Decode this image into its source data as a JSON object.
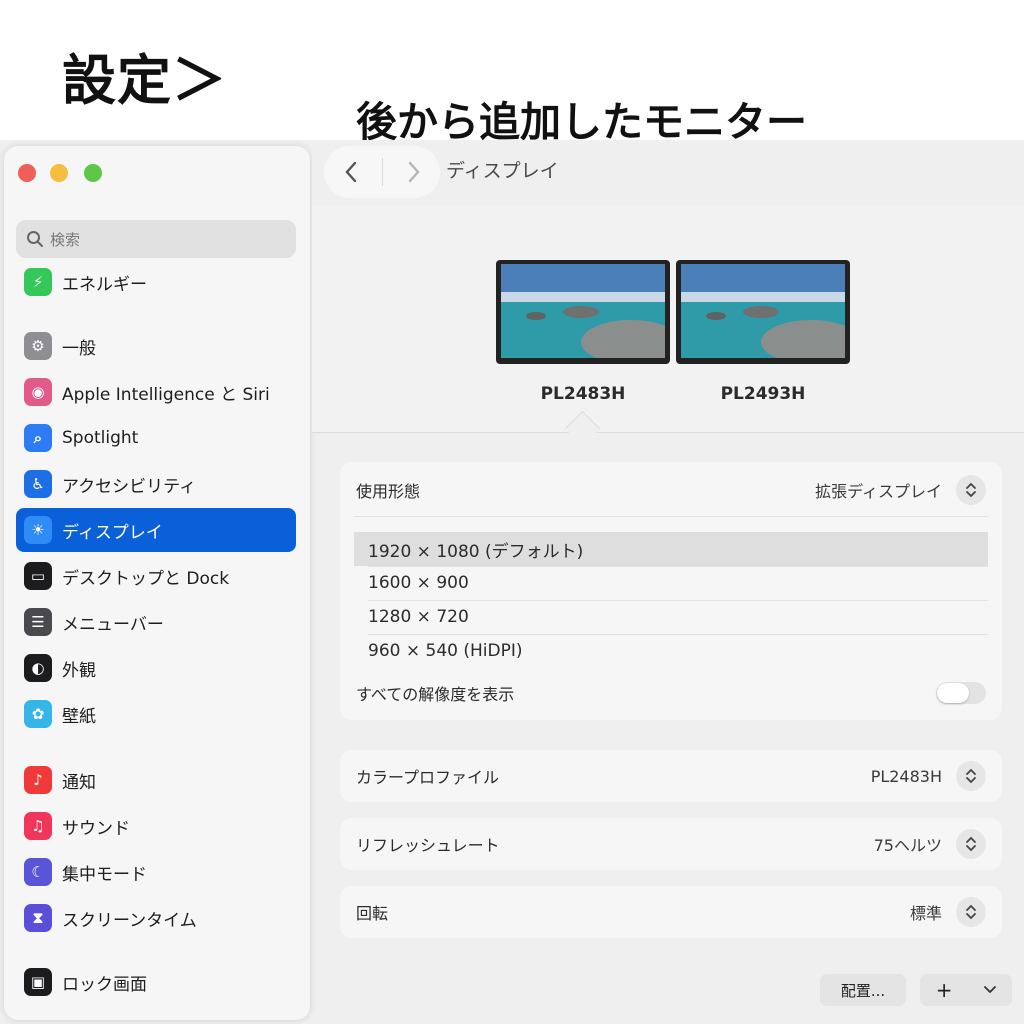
{
  "annotation": {
    "heading": "設定＞",
    "subheading": "後から追加したモニター"
  },
  "window": {
    "title": "ディスプレイ"
  },
  "sidebar": {
    "search_placeholder": "検索",
    "items": [
      {
        "label": "エネルギー",
        "icon": "bolt-icon",
        "color": "#34c759"
      },
      {
        "label": "一般",
        "icon": "gear-icon",
        "color": "#8e8e93"
      },
      {
        "label": "Apple Intelligence と Siri",
        "icon": "siri-icon",
        "color": "#e05a8a"
      },
      {
        "label": "Spotlight",
        "icon": "magnifier-icon",
        "color": "#2d7cf6"
      },
      {
        "label": "アクセシビリティ",
        "icon": "accessibility-icon",
        "color": "#1d6fe8"
      },
      {
        "label": "ディスプレイ",
        "icon": "sun-icon",
        "color": "#2f8cf4"
      },
      {
        "label": "デスクトップと Dock",
        "icon": "dock-icon",
        "color": "#1c1c1e"
      },
      {
        "label": "メニューバー",
        "icon": "menubar-icon",
        "color": "#4a4a4e"
      },
      {
        "label": "外観",
        "icon": "appearance-icon",
        "color": "#1c1c1e"
      },
      {
        "label": "壁紙",
        "icon": "flower-icon",
        "color": "#35b6e8"
      },
      {
        "label": "通知",
        "icon": "bell-icon",
        "color": "#f03a3a"
      },
      {
        "label": "サウンド",
        "icon": "speaker-icon",
        "color": "#f0365a"
      },
      {
        "label": "集中モード",
        "icon": "moon-icon",
        "color": "#5856d6"
      },
      {
        "label": "スクリーンタイム",
        "icon": "hourglass-icon",
        "color": "#5a4fd6"
      },
      {
        "label": "ロック画面",
        "icon": "lock-icon",
        "color": "#1c1c1e"
      }
    ],
    "active_index": 5
  },
  "displays": [
    {
      "name": "PL2483H"
    },
    {
      "name": "PL2493H"
    }
  ],
  "usage": {
    "label": "使用形態",
    "value": "拡張ディスプレイ"
  },
  "resolutions": {
    "options": [
      "1920 × 1080 (デフォルト)",
      "1600 × 900",
      "1280 × 720",
      "960 × 540 (HiDPI)"
    ],
    "selected_index": 0,
    "show_all_label": "すべての解像度を表示",
    "show_all_on": false
  },
  "color_profile": {
    "label": "カラープロファイル",
    "value": "PL2483H"
  },
  "refresh_rate": {
    "label": "リフレッシュレート",
    "value": "75ヘルツ"
  },
  "rotation": {
    "label": "回転",
    "value": "標準"
  },
  "bottom": {
    "arrange_label": "配置...",
    "add_label": "+"
  },
  "colors": {
    "accent": "#0a60d8",
    "arrow": "#e59a55"
  }
}
